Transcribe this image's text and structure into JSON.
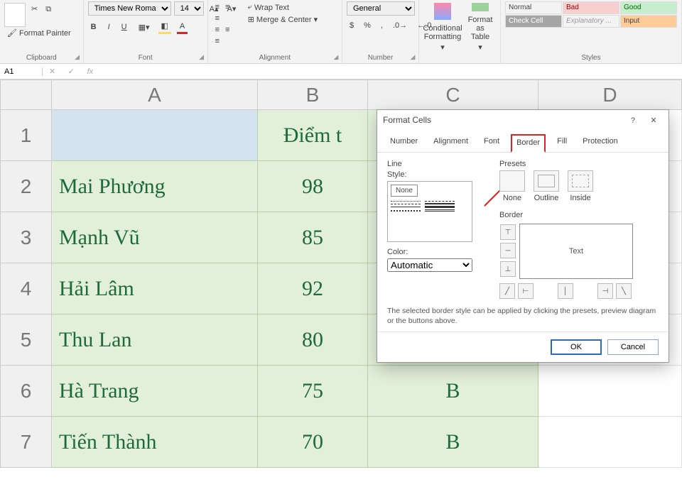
{
  "ribbon": {
    "clipboard": {
      "label": "Clipboard",
      "format_painter": "Format Painter"
    },
    "font": {
      "label": "Font",
      "name_value": "Times New Roma",
      "size_value": "14",
      "bold": "B",
      "italic": "I",
      "underline": "U"
    },
    "alignment": {
      "label": "Alignment",
      "wrap": "Wrap Text",
      "merge": "Merge & Center"
    },
    "number": {
      "label": "Number",
      "format": "General",
      "currency": "$",
      "percent": "%",
      "comma": ","
    },
    "formatting": {
      "cond": "Conditional Formatting",
      "table": "Format as Table"
    },
    "styles": {
      "label": "Styles",
      "items": [
        "Normal",
        "Bad",
        "Good",
        "Check Cell",
        "Explanatory ...",
        "Input"
      ]
    }
  },
  "namebox": {
    "value": "A1"
  },
  "fb": {
    "fx": "fx"
  },
  "grid": {
    "cols": [
      "A",
      "B",
      "C",
      "D"
    ],
    "rows": [
      "1",
      "2",
      "3",
      "4",
      "5",
      "6",
      "7"
    ],
    "data": {
      "B1": "Điểm t",
      "A2": "Mai Phương",
      "B2": "98",
      "A3": "Mạnh Vũ",
      "B3": "85",
      "A4": "Hải Lâm",
      "B4": "92",
      "A5": "Thu Lan",
      "B5": "80",
      "A6": "Hà Trang",
      "B6": "75",
      "C6": "B",
      "A7": "Tiến Thành",
      "B7": "70",
      "C7": "B"
    }
  },
  "dialog": {
    "title": "Format Cells",
    "tabs": {
      "number": "Number",
      "alignment": "Alignment",
      "font": "Font",
      "border": "Border",
      "fill": "Fill",
      "protection": "Protection"
    },
    "line_legend": "Line",
    "style_label": "Style:",
    "none_label": "None",
    "color_label": "Color:",
    "color_value": "Automatic",
    "presets_legend": "Presets",
    "preset_none": "None",
    "preset_outline": "Outline",
    "preset_inside": "Inside",
    "border_legend": "Border",
    "preview_text": "Text",
    "hint": "The selected border style can be applied by clicking the presets, preview diagram or the buttons above.",
    "ok": "OK",
    "cancel": "Cancel",
    "help": "?",
    "close": "✕"
  }
}
